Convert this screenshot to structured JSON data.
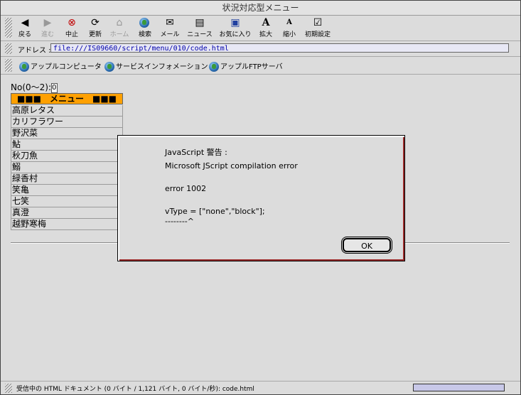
{
  "window": {
    "title": "状況対応型メニュー"
  },
  "toolbar": {
    "buttons": [
      {
        "label": "戻る",
        "icon": "back-arrow-icon"
      },
      {
        "label": "進む",
        "icon": "forward-arrow-icon"
      },
      {
        "label": "中止",
        "icon": "stop-icon"
      },
      {
        "label": "更新",
        "icon": "refresh-icon"
      },
      {
        "label": "ホーム",
        "icon": "home-icon"
      },
      {
        "label": "検索",
        "icon": "search-icon"
      },
      {
        "label": "メール",
        "icon": "mail-icon"
      },
      {
        "label": "ニュース",
        "icon": "news-icon"
      },
      {
        "label": "お気に入り",
        "icon": "favorites-icon"
      },
      {
        "label": "拡大",
        "icon": "text-larger-icon"
      },
      {
        "label": "縮小",
        "icon": "text-smaller-icon"
      },
      {
        "label": "初期設定",
        "icon": "preferences-icon"
      }
    ]
  },
  "address": {
    "label": "アドレス :",
    "value": "file:///IS09660/script/menu/010/code.html"
  },
  "favorites": [
    {
      "label": "アップルコンピュータ"
    },
    {
      "label": "サービスインフォメーション"
    },
    {
      "label": "アップルFTPサーバ"
    }
  ],
  "page": {
    "no_label": "No(0〜2):",
    "no_value": "0",
    "menu_header": "■■■　メニュー　■■■",
    "menu_items": [
      "高原レタス",
      "カリフラワー",
      "野沢菜",
      "鮎",
      "秋刀魚",
      "鰯",
      "緑香村",
      "笑亀",
      "七笑",
      "真澄",
      "越野寒梅"
    ]
  },
  "dialog": {
    "title": "JavaScript 警告 :",
    "line1": "Microsoft JScript compilation error",
    "line2": "error 1002",
    "line3": "vType = [\"none\",\"block\"];",
    "line4": "--------^",
    "ok_label": "OK"
  },
  "status": {
    "text": "受信中の HTML ドキュメント (0 バイト / 1,121 バイト, 0 バイト/秒): code.html"
  }
}
